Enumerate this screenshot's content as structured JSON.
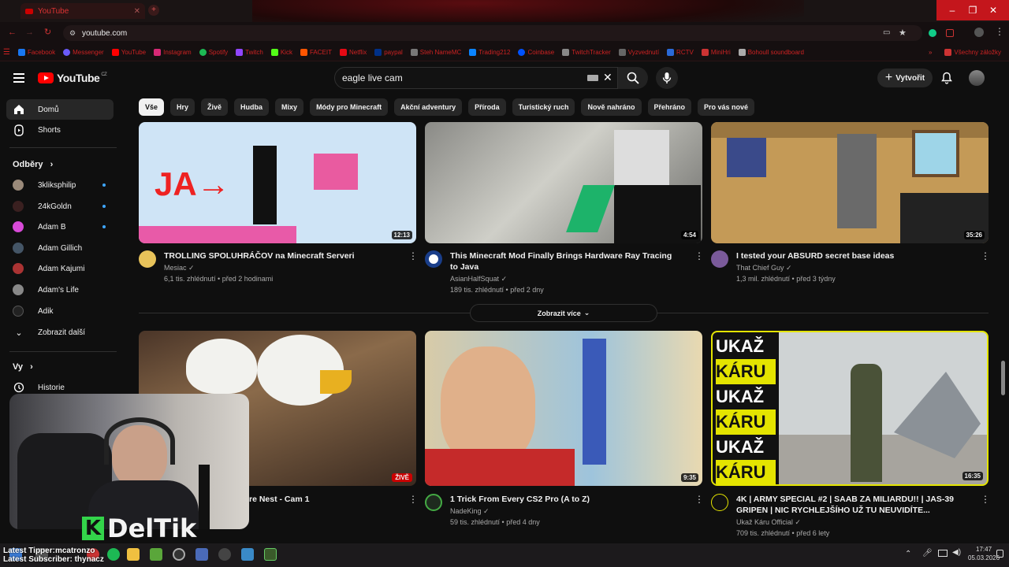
{
  "browser": {
    "tab_title": "YouTube",
    "url": "youtube.com",
    "bookmarks": [
      "Facebook",
      "Messenger",
      "YouTube",
      "Instagram",
      "Spotify",
      "Twitch",
      "Kick",
      "FACEIT",
      "Netflix",
      "paypal",
      "Steh NameMC",
      "Trading212",
      "Coinbase",
      "TwitchTracker",
      "Vyzvednutí",
      "RCTV",
      "MiniHri",
      "Bohoull soundboard"
    ],
    "all_bookmarks": "Všechny záložky"
  },
  "header": {
    "logo": "YouTube",
    "country": "CZ",
    "search_value": "eagle live cam",
    "create_label": "Vytvořit"
  },
  "chips": [
    "Vše",
    "Hry",
    "Živě",
    "Hudba",
    "Mixy",
    "Módy pro Minecraft",
    "Akční adventury",
    "Příroda",
    "Turistický ruch",
    "Nově nahráno",
    "Přehráno",
    "Pro vás nové"
  ],
  "sidebar": {
    "home": "Domů",
    "shorts": "Shorts",
    "subs_heading": "Odběry",
    "subs": [
      "3kliksphilip",
      "24kGoldn",
      "Adam B",
      "Adam Gillich",
      "Adam Kajumi",
      "Adam's Life",
      "Adik"
    ],
    "show_more": "Zobrazit další",
    "you_heading": "Vy",
    "history": "Historie"
  },
  "videos_row1": [
    {
      "title": "TROLLING SPOLUHRÁČOV na Minecraft Serveri",
      "channel": "Mesiac",
      "views": "6,1 tis. zhlédnutí",
      "age": "před 2 hodinami",
      "duration": "12:13"
    },
    {
      "title": "This Minecraft Mod Finally Brings Hardware Ray Tracing to Java",
      "channel": "AsianHalfSquat",
      "views": "189 tis. zhlédnutí",
      "age": "před 2 dny",
      "duration": "4:54"
    },
    {
      "title": "I tested your ABSURD secret base ideas",
      "channel": "That Chief Guy",
      "views": "1,3 mil. zhlédnutí",
      "age": "před 3 týdny",
      "duration": "35:26"
    }
  ],
  "show_more_button": "Zobrazit více",
  "videos_row2": [
    {
      "title": "re Nest - Cam 1",
      "badge": "ŽIVĚ"
    },
    {
      "title": "1 Trick From Every CS2 Pro (A to Z)",
      "channel": "NadeKing",
      "views": "59 tis. zhlédnutí",
      "age": "před 4 dny",
      "duration": "9:35"
    },
    {
      "title": "4K | ARMY SPECIAL #2 | SAAB ZA MILIARDU!! | JAS-39 GRIPEN | NIC RYCHLEJŠÍHO UŽ TU NEUVIDÍTE...",
      "channel": "Ukaž Káru Official",
      "views": "709 tis. zhlédnutí",
      "age": "před 6 lety",
      "duration": "16:35",
      "thumb_text": [
        "UKAŽ",
        "KÁRU",
        "UKAŽ",
        "KÁRU",
        "UKAŽ",
        "KÁRU"
      ]
    }
  ],
  "stream_overlay": {
    "brand": "DelTik",
    "brand_letter": "K",
    "latest_tipper": "Latest Tipper:mcatronzo",
    "latest_subscriber": "Latest Subscriber: thynacz"
  },
  "taskbar": {
    "time": "17:47",
    "date": "05.03.2026"
  },
  "colors": {
    "bg": "#0f0f0f",
    "accent": "#ff0000",
    "chip": "#272727",
    "window_close": "#c4161c"
  }
}
